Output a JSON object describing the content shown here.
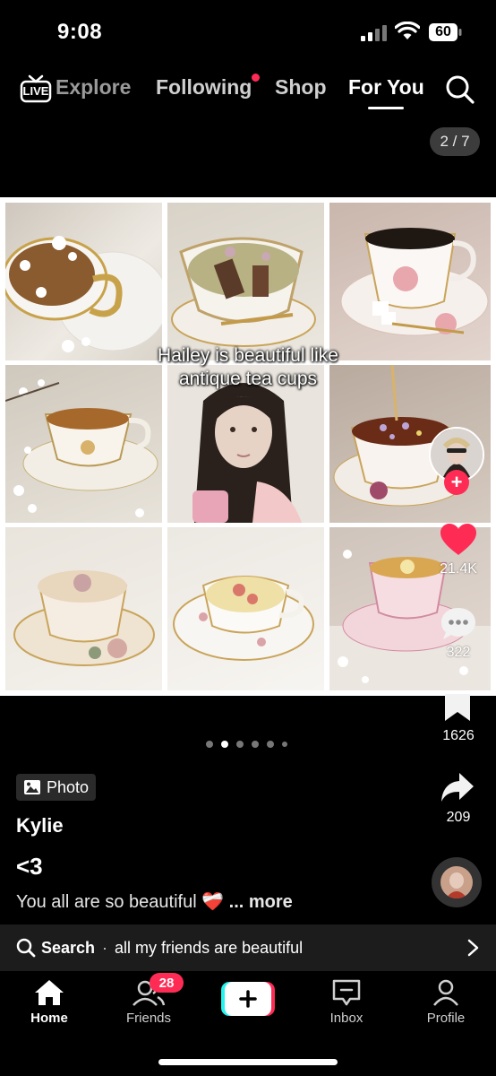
{
  "status_bar": {
    "time": "9:08",
    "battery": "60"
  },
  "top_nav": {
    "live_label": "LIVE",
    "tabs": [
      {
        "label": "Explore"
      },
      {
        "label": "Following"
      },
      {
        "label": "Shop"
      },
      {
        "label": "For You"
      }
    ],
    "active_tab": "For You",
    "following_has_dot": true
  },
  "post": {
    "image_counter": "2 / 7",
    "caption_line1": "Hailey is beautiful like",
    "caption_line2": "antique tea cups",
    "carousel_total": 6,
    "carousel_active": 1,
    "photo_badge": "Photo",
    "author": "Kylie",
    "title": "<3",
    "description": "You all are so beautiful",
    "description_emoji": "❤️‍🩹",
    "more_label": "... more"
  },
  "actions": {
    "likes": "21.4K",
    "comments": "322",
    "saves": "1626",
    "shares": "209"
  },
  "search_suggestion": {
    "label": "Search",
    "separator": "·",
    "query": "all my friends are beautiful"
  },
  "bottom_nav": {
    "home": "Home",
    "friends": "Friends",
    "friends_badge": "28",
    "inbox": "Inbox",
    "profile": "Profile"
  },
  "colors": {
    "accent": "#fe2c55",
    "cyan": "#25f4ee",
    "background": "#000000"
  }
}
